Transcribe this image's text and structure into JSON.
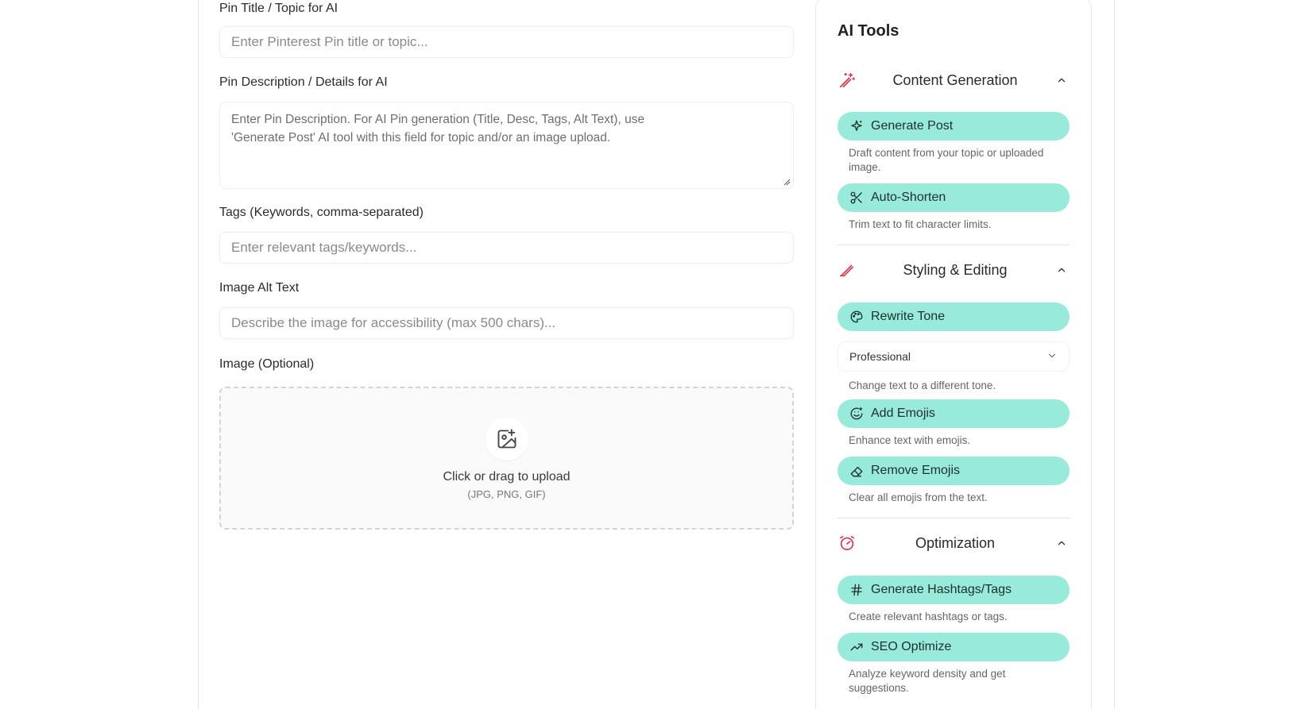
{
  "form": {
    "title_label": "Pin Title / Topic for AI",
    "title_placeholder": "Enter Pinterest Pin title or topic...",
    "desc_label": "Pin Description / Details for AI",
    "desc_placeholder_line1": "Enter Pin Description. For AI Pin generation (Title, Desc, Tags, Alt Text), use",
    "desc_placeholder_line2": "'Generate Post' AI tool with this field for topic and/or an image upload.",
    "tags_label": "Tags (Keywords, comma-separated)",
    "tags_placeholder": "Enter relevant tags/keywords...",
    "alt_label": "Image Alt Text",
    "alt_placeholder": "Describe the image for accessibility (max 500 chars)...",
    "image_label": "Image (Optional)",
    "upload_title": "Click or drag to upload",
    "upload_sub": "(JPG, PNG, GIF)"
  },
  "ai_tools": {
    "title": "AI Tools",
    "sections": [
      {
        "title": "Content Generation",
        "icon": "magic-wand-icon",
        "tools": [
          {
            "label": "Generate Post",
            "icon": "sparkles-icon",
            "desc": "Draft content from your topic or uploaded image."
          },
          {
            "label": "Auto-Shorten",
            "icon": "scissors-icon",
            "desc": "Trim text to fit character limits."
          }
        ]
      },
      {
        "title": "Styling & Editing",
        "icon": "pen-icon",
        "tools": [
          {
            "label": "Rewrite Tone",
            "icon": "palette-icon",
            "desc": "Change text to a different tone.",
            "select_value": "Professional"
          },
          {
            "label": "Add Emojis",
            "icon": "smile-plus-icon",
            "desc": "Enhance text with emojis."
          },
          {
            "label": "Remove Emojis",
            "icon": "eraser-icon",
            "desc": "Clear all emojis from the text."
          }
        ]
      },
      {
        "title": "Optimization",
        "icon": "gauge-icon",
        "tools": [
          {
            "label": "Generate Hashtags/Tags",
            "icon": "hash-icon",
            "desc": "Create relevant hashtags or tags."
          },
          {
            "label": "SEO Optimize",
            "icon": "trending-up-icon",
            "desc": "Analyze keyword density and get suggestions."
          }
        ]
      }
    ]
  },
  "colors": {
    "accent_button": "#98eadb",
    "section_icon": "#e0324b"
  }
}
